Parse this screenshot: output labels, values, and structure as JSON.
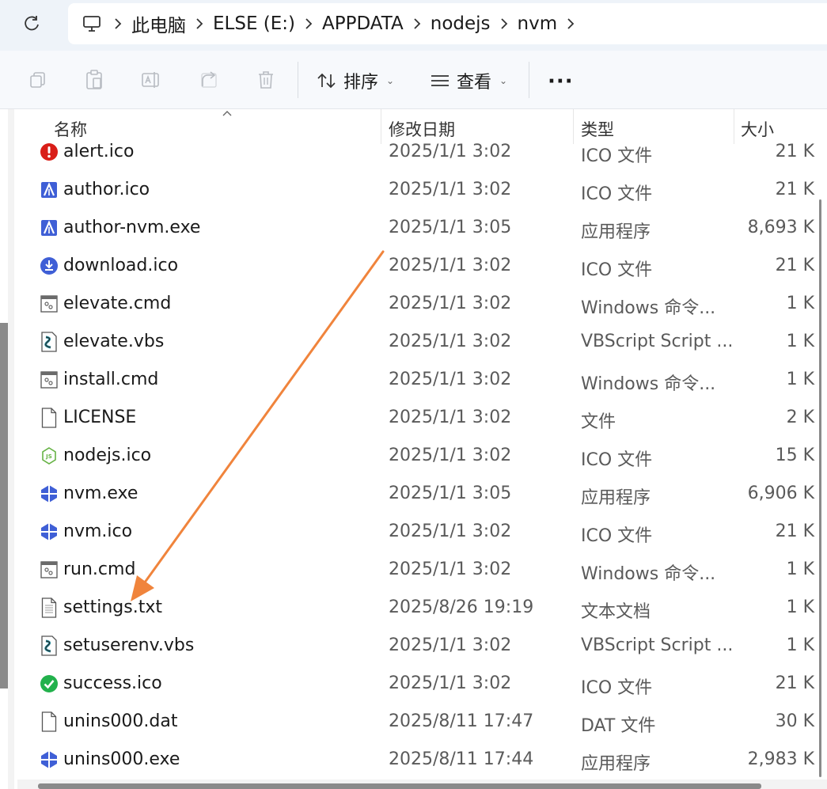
{
  "breadcrumb": [
    "此电脑",
    "ELSE (E:)",
    "APPDATA",
    "nodejs",
    "nvm"
  ],
  "toolbar": {
    "sort_label": "排序",
    "view_label": "查看",
    "more_label": "···"
  },
  "columns": {
    "name": "名称",
    "date": "修改日期",
    "type": "类型",
    "size": "大小"
  },
  "files": [
    {
      "name": "alert.ico",
      "date": "2025/1/1 3:02",
      "type": "ICO 文件",
      "size": "21 K",
      "icon": "alert-icon"
    },
    {
      "name": "author.ico",
      "date": "2025/1/1 3:02",
      "type": "ICO 文件",
      "size": "21 K",
      "icon": "author-icon"
    },
    {
      "name": "author-nvm.exe",
      "date": "2025/1/1 3:05",
      "type": "应用程序",
      "size": "8,693 K",
      "icon": "author-icon"
    },
    {
      "name": "download.ico",
      "date": "2025/1/1 3:02",
      "type": "ICO 文件",
      "size": "21 K",
      "icon": "download-icon"
    },
    {
      "name": "elevate.cmd",
      "date": "2025/1/1 3:02",
      "type": "Windows 命令...",
      "size": "1 K",
      "icon": "cmd-file-icon"
    },
    {
      "name": "elevate.vbs",
      "date": "2025/1/1 3:02",
      "type": "VBScript Script ...",
      "size": "1 K",
      "icon": "vbs-file-icon"
    },
    {
      "name": "install.cmd",
      "date": "2025/1/1 3:02",
      "type": "Windows 命令...",
      "size": "1 K",
      "icon": "cmd-file-icon"
    },
    {
      "name": "LICENSE",
      "date": "2025/1/1 3:02",
      "type": "文件",
      "size": "2 K",
      "icon": "blank-file-icon"
    },
    {
      "name": "nodejs.ico",
      "date": "2025/1/1 3:02",
      "type": "ICO 文件",
      "size": "15 K",
      "icon": "nodejs-icon"
    },
    {
      "name": "nvm.exe",
      "date": "2025/1/1 3:05",
      "type": "应用程序",
      "size": "6,906 K",
      "icon": "nvm-icon"
    },
    {
      "name": "nvm.ico",
      "date": "2025/1/1 3:02",
      "type": "ICO 文件",
      "size": "21 K",
      "icon": "nvm-icon"
    },
    {
      "name": "run.cmd",
      "date": "2025/1/1 3:02",
      "type": "Windows 命令...",
      "size": "1 K",
      "icon": "cmd-file-icon"
    },
    {
      "name": "settings.txt",
      "date": "2025/8/26 19:19",
      "type": "文本文档",
      "size": "1 K",
      "icon": "text-file-icon"
    },
    {
      "name": "setuserenv.vbs",
      "date": "2025/1/1 3:02",
      "type": "VBScript Script ...",
      "size": "1 K",
      "icon": "vbs-file-icon"
    },
    {
      "name": "success.ico",
      "date": "2025/1/1 3:02",
      "type": "ICO 文件",
      "size": "21 K",
      "icon": "success-icon"
    },
    {
      "name": "unins000.dat",
      "date": "2025/8/11 17:47",
      "type": "DAT 文件",
      "size": "30 K",
      "icon": "blank-file-icon"
    },
    {
      "name": "unins000.exe",
      "date": "2025/8/11 17:44",
      "type": "应用程序",
      "size": "2,983 K",
      "icon": "nvm-icon"
    }
  ],
  "colors": {
    "accent": "#1a66c8",
    "arrow": "#f0843c",
    "alert": "#d91e18",
    "success": "#22b14c",
    "nvm": "#3f5fd6",
    "nodejs": "#67b346"
  }
}
